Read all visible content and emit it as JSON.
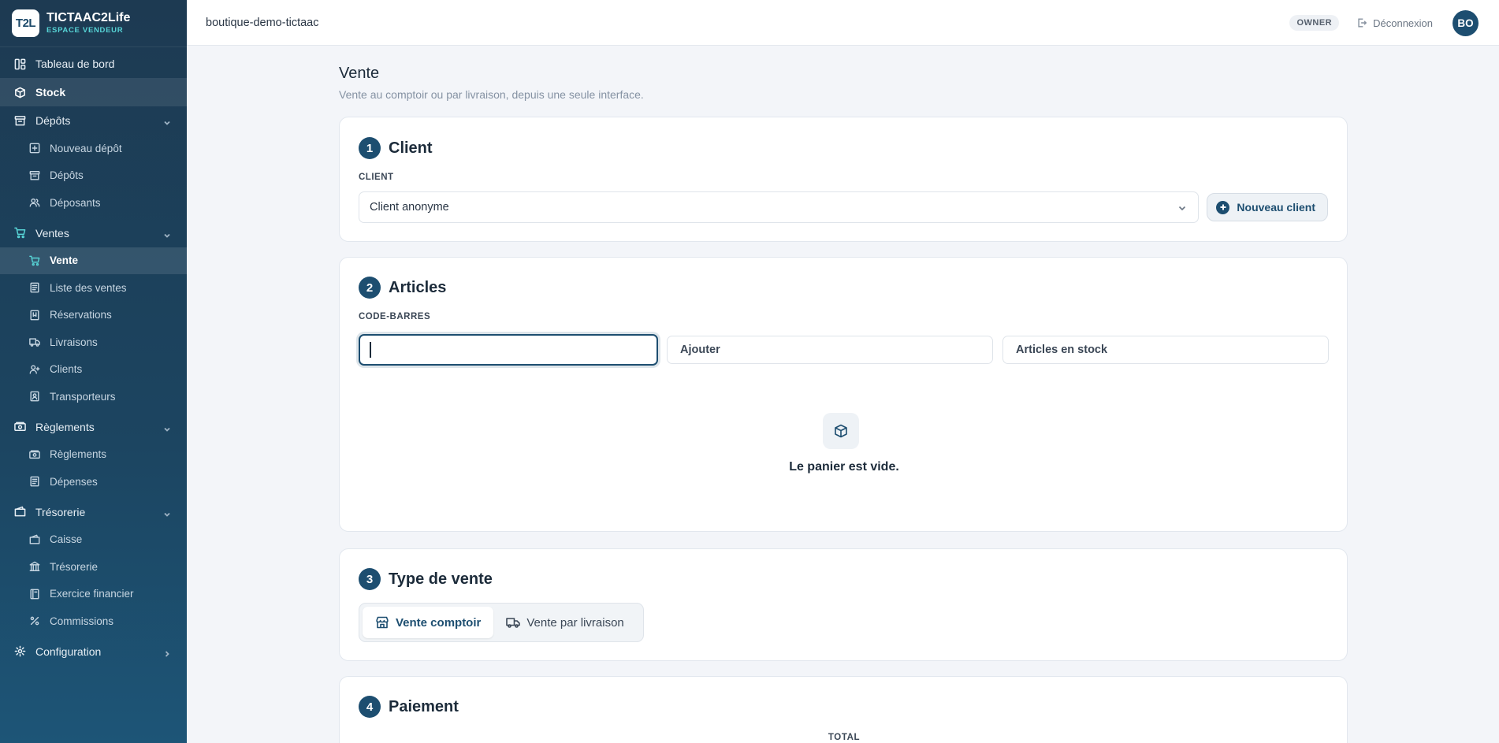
{
  "brand": {
    "logo_text": "T2L",
    "name": "TICTAAC2Life",
    "subtitle": "ESPACE VENDEUR"
  },
  "sidebar": {
    "items": [
      {
        "label": "Tableau de bord",
        "icon": "dashboard-icon"
      },
      {
        "label": "Stock",
        "icon": "box-icon",
        "active": true
      },
      {
        "label": "Dépôts",
        "icon": "archive-icon",
        "expanded": true
      },
      {
        "label": "Nouveau dépôt",
        "icon": "plus-square-icon"
      },
      {
        "label": "Dépôts",
        "icon": "archive-icon"
      },
      {
        "label": "Déposants",
        "icon": "users-icon"
      },
      {
        "label": "Ventes",
        "icon": "cart-icon",
        "expanded": true
      },
      {
        "label": "Vente",
        "icon": "cart-icon",
        "active": true
      },
      {
        "label": "Liste des ventes",
        "icon": "receipt-icon"
      },
      {
        "label": "Réservations",
        "icon": "bookmark-icon"
      },
      {
        "label": "Livraisons",
        "icon": "truck-icon"
      },
      {
        "label": "Clients",
        "icon": "user-plus-icon"
      },
      {
        "label": "Transporteurs",
        "icon": "id-badge-icon"
      },
      {
        "label": "Règlements",
        "icon": "banknote-icon",
        "expanded": true
      },
      {
        "label": "Règlements",
        "icon": "banknote-icon"
      },
      {
        "label": "Dépenses",
        "icon": "receipt-icon"
      },
      {
        "label": "Trésorerie",
        "icon": "wallet-icon",
        "expanded": true
      },
      {
        "label": "Caisse",
        "icon": "wallet-icon"
      },
      {
        "label": "Trésorerie",
        "icon": "bank-icon"
      },
      {
        "label": "Exercice financier",
        "icon": "ledger-icon"
      },
      {
        "label": "Commissions",
        "icon": "percent-icon"
      },
      {
        "label": "Configuration",
        "icon": "gear-icon",
        "expanded": false
      }
    ]
  },
  "topbar": {
    "shop_name": "boutique-demo-tictaac",
    "role": "OWNER",
    "logout_label": "Déconnexion",
    "avatar_initials": "BO"
  },
  "page": {
    "title": "Vente",
    "subtitle": "Vente au comptoir ou par livraison, depuis une seule interface."
  },
  "client_section": {
    "step": "1",
    "title": "Client",
    "field_label": "CLIENT",
    "selected_client": "Client anonyme",
    "new_client_label": "Nouveau client"
  },
  "articles_section": {
    "step": "2",
    "title": "Articles",
    "field_label": "CODE-BARRES",
    "barcode_value": "",
    "add_label": "Ajouter",
    "stock_label": "Articles en stock",
    "empty_text": "Le panier est vide."
  },
  "sale_type_section": {
    "step": "3",
    "title": "Type de vente",
    "options": [
      {
        "label": "Vente comptoir",
        "icon": "store-icon",
        "selected": true
      },
      {
        "label": "Vente par livraison",
        "icon": "truck-icon",
        "selected": false
      }
    ]
  },
  "payment_section": {
    "step": "4",
    "title": "Paiement",
    "total_label": "TOTAL"
  },
  "colors": {
    "primary": "#1d4e70",
    "accent": "#57d4d6",
    "sidebar_top": "#1d3a52",
    "sidebar_bottom": "#1d5577",
    "background": "#f3f5f9"
  }
}
